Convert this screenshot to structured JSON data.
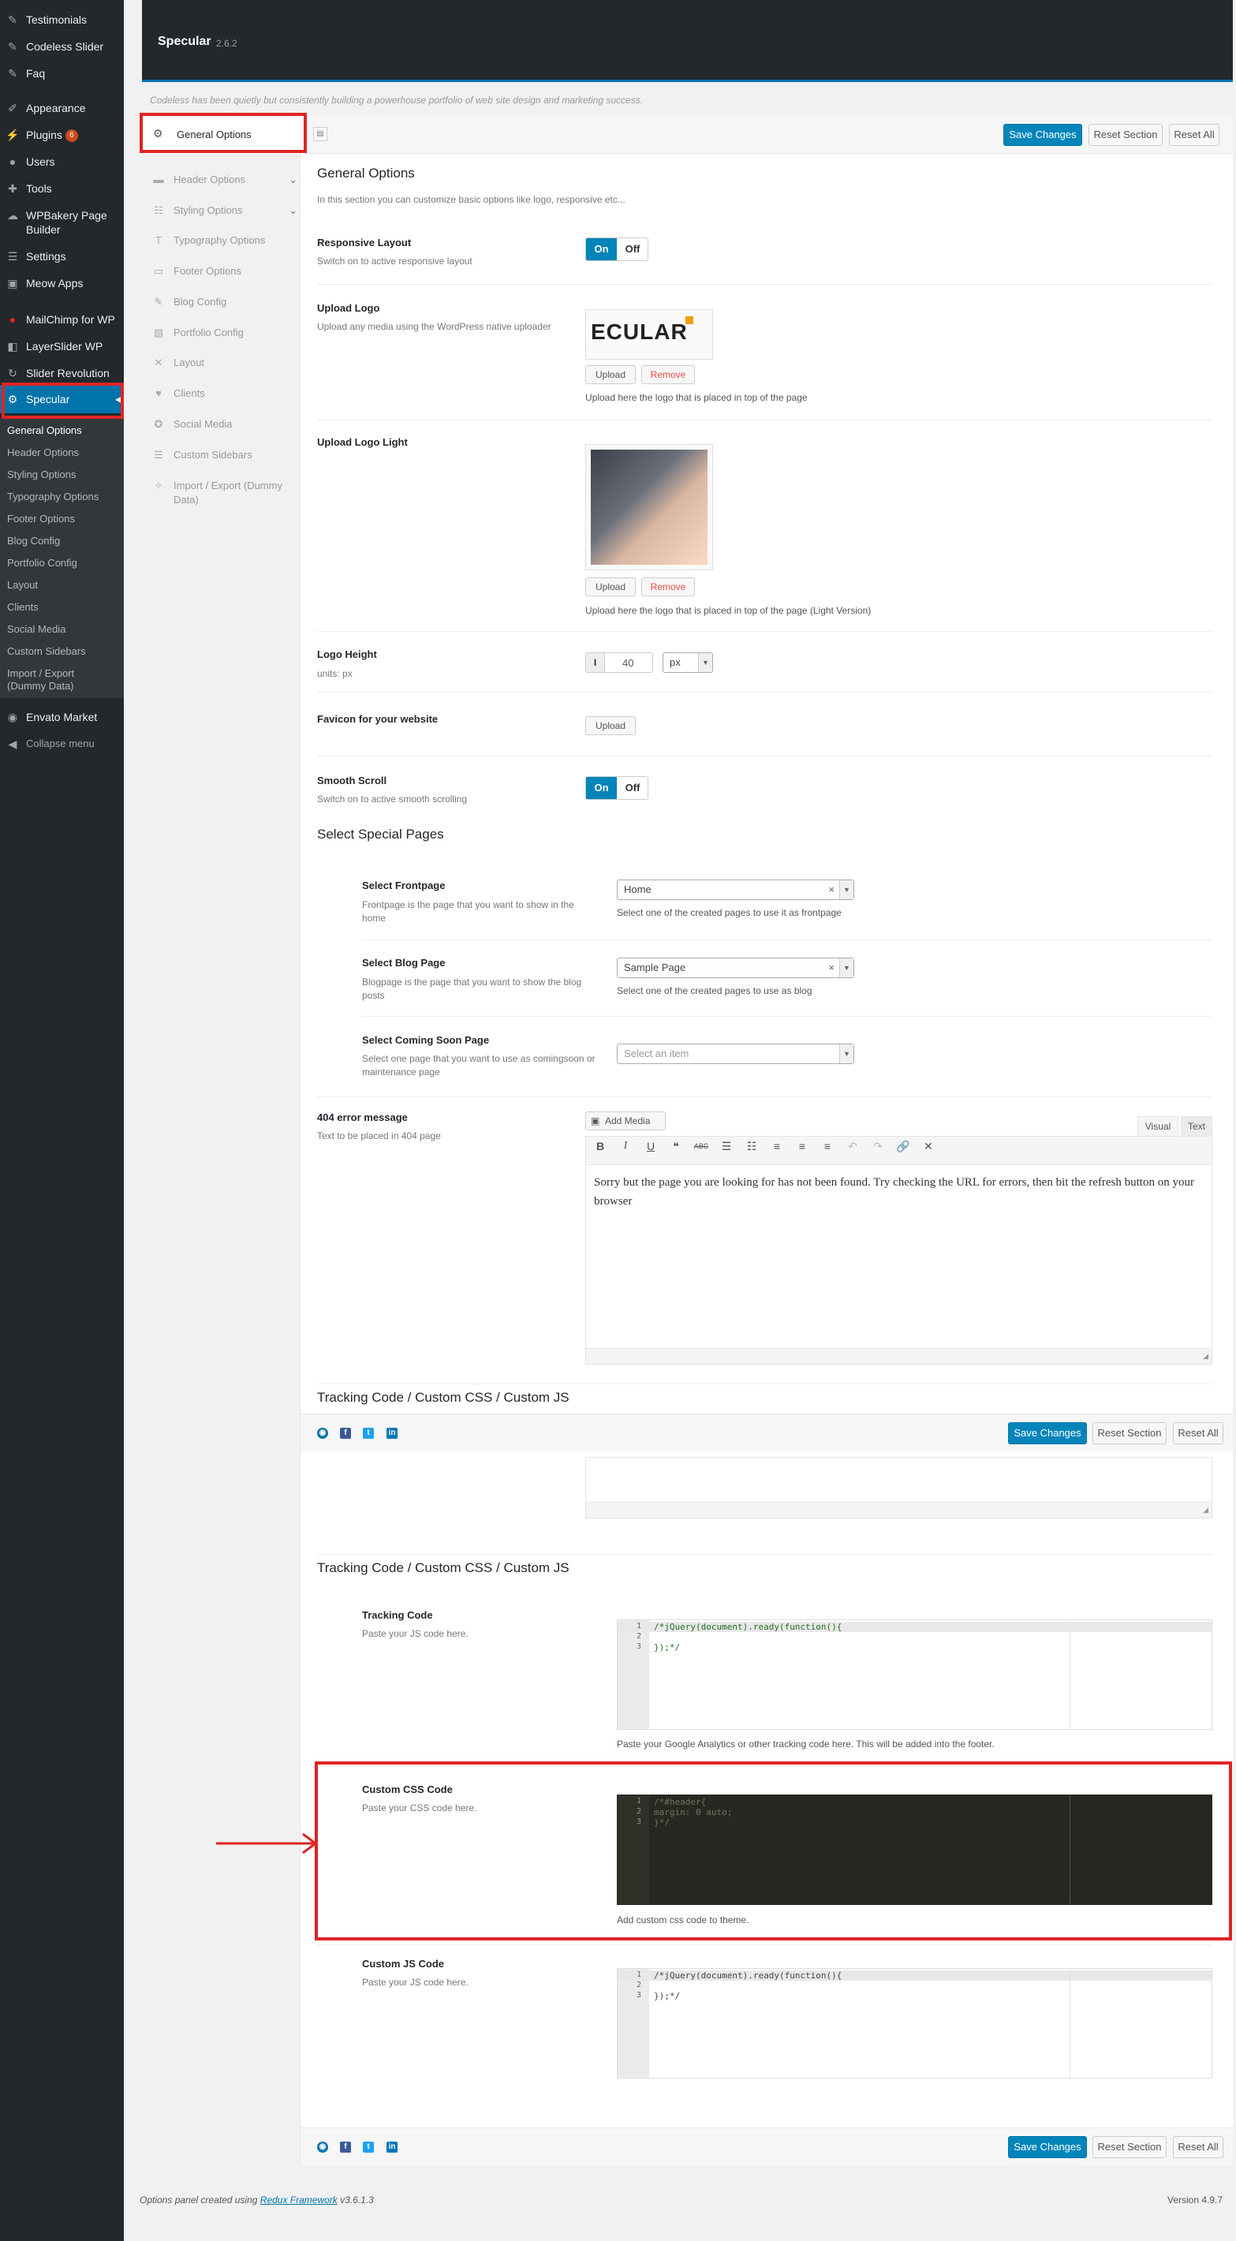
{
  "admin_menu": {
    "items_top": [
      {
        "label": "Testimonials",
        "icon": "pin-icon"
      },
      {
        "label": "Codeless Slider",
        "icon": "pin-icon"
      },
      {
        "label": "Faq",
        "icon": "pin-icon"
      }
    ],
    "appearance": "Appearance",
    "plugins": "Plugins",
    "plugins_badge": "6",
    "users": "Users",
    "tools": "Tools",
    "wpbakery": "WPBakery Page Builder",
    "settings": "Settings",
    "meow": "Meow Apps",
    "mailchimp": "MailChimp for WP",
    "layerslider": "LayerSlider WP",
    "sliderrev": "Slider Revolution",
    "specular": "Specular",
    "submenu": [
      "General Options",
      "Header Options",
      "Styling Options",
      "Typography Options",
      "Footer Options",
      "Blog Config",
      "Portfolio Config",
      "Layout",
      "Clients",
      "Social Media",
      "Custom Sidebars",
      "Import / Export (Dummy Data)"
    ],
    "envato": "Envato Market",
    "collapse": "Collapse menu"
  },
  "header": {
    "title": "Specular",
    "version": "2.6.2"
  },
  "intro": "Codeless has been quietly but consistently building a powerhouse portfolio of web site design and marketing success.",
  "toolbar": {
    "save": "Save Changes",
    "reset_section": "Reset Section",
    "reset_all": "Reset All"
  },
  "nav": {
    "active": "General Options",
    "items": [
      "Header Options",
      "Styling Options",
      "Typography Options",
      "Footer Options",
      "Blog Config",
      "Portfolio Config",
      "Layout",
      "Clients",
      "Social Media",
      "Custom Sidebars",
      "Import / Export (Dummy Data)"
    ]
  },
  "general": {
    "title": "General Options",
    "desc": "In this section you can customize basic options like logo, responsive etc...",
    "responsive_title": "Responsive Layout",
    "responsive_desc": "Switch on to active responsive layout",
    "on": "On",
    "off": "Off",
    "logo_title": "Upload Logo",
    "logo_desc": "Upload any media using the WordPress native uploader",
    "logo_text": "ECULAR",
    "upload": "Upload",
    "remove": "Remove",
    "logo_help": "Upload here the logo that is placed in top of the page",
    "logo_light_title": "Upload Logo Light",
    "logo_light_help": "Upload here the logo that is placed in top of the page (Light Version)",
    "logo_height_title": "Logo Height",
    "logo_height_desc": "units: px",
    "logo_height_value": "40",
    "logo_height_unit": "px",
    "favicon_title": "Favicon for your website",
    "smooth_title": "Smooth Scroll",
    "smooth_desc": "Switch on to active smooth scrolling"
  },
  "special": {
    "title": "Select Special Pages",
    "front_title": "Select Frontpage",
    "front_desc": "Frontpage is the page that you want to show in the home",
    "front_value": "Home",
    "front_help": "Select one of the created pages to use it as frontpage",
    "blog_title": "Select Blog Page",
    "blog_desc": "Blogpage is the page that you want to show the blog posts",
    "blog_value": "Sample Page",
    "blog_help": "Select one of the created pages to use as blog",
    "soon_title": "Select Coming Soon Page",
    "soon_desc": "Select one page that you want to use as comingsoon or maintenance page",
    "soon_placeholder": "Select an item",
    "e404_title": "404 error message",
    "e404_desc": "Text to be placed in 404 page",
    "add_media": "Add Media",
    "tab_visual": "Visual",
    "tab_text": "Text",
    "e404_text": "Sorry but the page you are looking for has not been found. Try checking the URL for errors, then bit the refresh button on your browser"
  },
  "tracking": {
    "title": "Tracking Code / Custom CSS / Custom JS",
    "tc_title": "Tracking Code",
    "tc_desc": "Paste your JS code here.",
    "tc_lines": [
      "/*jQuery(document).ready(function(){",
      "",
      "});*/"
    ],
    "tc_help": "Paste your Google Analytics or other tracking code here. This will be added into the footer.",
    "css_title": "Custom CSS Code",
    "css_desc": "Paste your CSS code here.",
    "css_lines": [
      "/*#header{",
      "margin: 0 auto;",
      "}*/"
    ],
    "css_help": "Add custom css code to theme.",
    "js_title": "Custom JS Code",
    "js_desc": "Paste your JS code here.",
    "js_lines": [
      "/*jQuery(document).ready(function(){",
      "",
      "});*/"
    ]
  },
  "line_numbers": [
    "1",
    "2",
    "3"
  ],
  "footer": {
    "credit_pre": "Options panel created using",
    "credit_link": "Redux Framework",
    "credit_post": "v3.6.1.3",
    "version": "Version 4.9.7"
  },
  "colors": {
    "accent": "#0073aa",
    "highlight": "#e02424",
    "editor_bg": "#272822"
  }
}
